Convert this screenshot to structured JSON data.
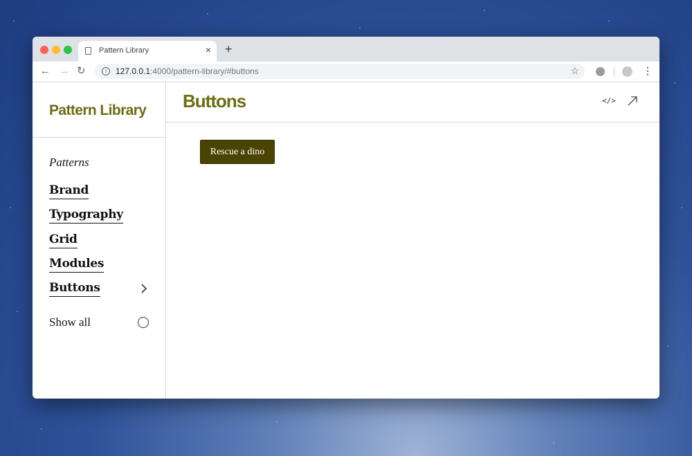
{
  "browser": {
    "tab_title": "Pattern Library",
    "tab_close": "×",
    "new_tab": "+",
    "nav_back": "←",
    "nav_forward": "→",
    "nav_reload": "↻",
    "url_host": "127.0.0.1",
    "url_rest": ":4000/pattern-library/#buttons",
    "bookmark_star": "☆",
    "menu": "⋮"
  },
  "sidebar": {
    "brand": "Pattern Library",
    "section_label": "Patterns",
    "items": [
      {
        "label": "Brand"
      },
      {
        "label": "Typography"
      },
      {
        "label": "Grid"
      },
      {
        "label": "Modules"
      },
      {
        "label": "Buttons",
        "active": true
      }
    ],
    "show_all": "Show all"
  },
  "main": {
    "title": "Buttons",
    "code_icon": "</>",
    "demo_button": "Rescue a dino"
  },
  "colors": {
    "brand_accent": "#6d6d12",
    "demo_button_bg": "#4a4403"
  }
}
